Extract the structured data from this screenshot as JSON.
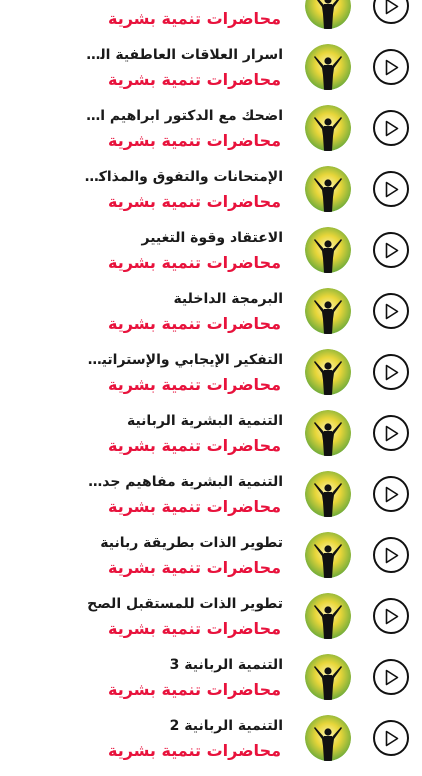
{
  "colors": {
    "subtitle": "#e8123c",
    "title": "#1a1a1a",
    "play_border": "#111111"
  },
  "icons": {
    "play": "play-circle-icon",
    "thumbnail": "raised-arms-silhouette-icon"
  },
  "items": [
    {
      "title": "",
      "subtitle": "محاضرات تنمية بشرية"
    },
    {
      "title": "اسرار العلاقات العاطفية الناجحة",
      "subtitle": "محاضرات تنمية بشرية"
    },
    {
      "title": "اضحك مع الدكتور ابراهيم الفقي",
      "subtitle": "محاضرات تنمية بشرية"
    },
    {
      "title": "الإمتحانات والتفوق والمذاكرة",
      "subtitle": "محاضرات تنمية بشرية"
    },
    {
      "title": "الاعتقاد وقوة التغيير",
      "subtitle": "محاضرات تنمية بشرية"
    },
    {
      "title": "البرمجة الداخلية",
      "subtitle": "محاضرات تنمية بشرية"
    },
    {
      "title": "التفكير الإيجابي والإستراتيجي",
      "subtitle": "محاضرات تنمية بشرية"
    },
    {
      "title": "التنمية البشرية الربانية",
      "subtitle": "محاضرات تنمية بشرية"
    },
    {
      "title": "التنمية البشرية مفاهيم جديدة",
      "subtitle": "محاضرات تنمية بشرية"
    },
    {
      "title": "تطوير الذات بطريقة ربانية",
      "subtitle": "محاضرات تنمية بشرية"
    },
    {
      "title": "تطوير الذات للمستقبل الصح",
      "subtitle": "محاضرات تنمية بشرية"
    },
    {
      "title": "التنمية الربانية 3",
      "subtitle": "محاضرات تنمية بشرية"
    },
    {
      "title": "التنمية الربانية 2",
      "subtitle": "محاضرات تنمية بشرية"
    }
  ]
}
